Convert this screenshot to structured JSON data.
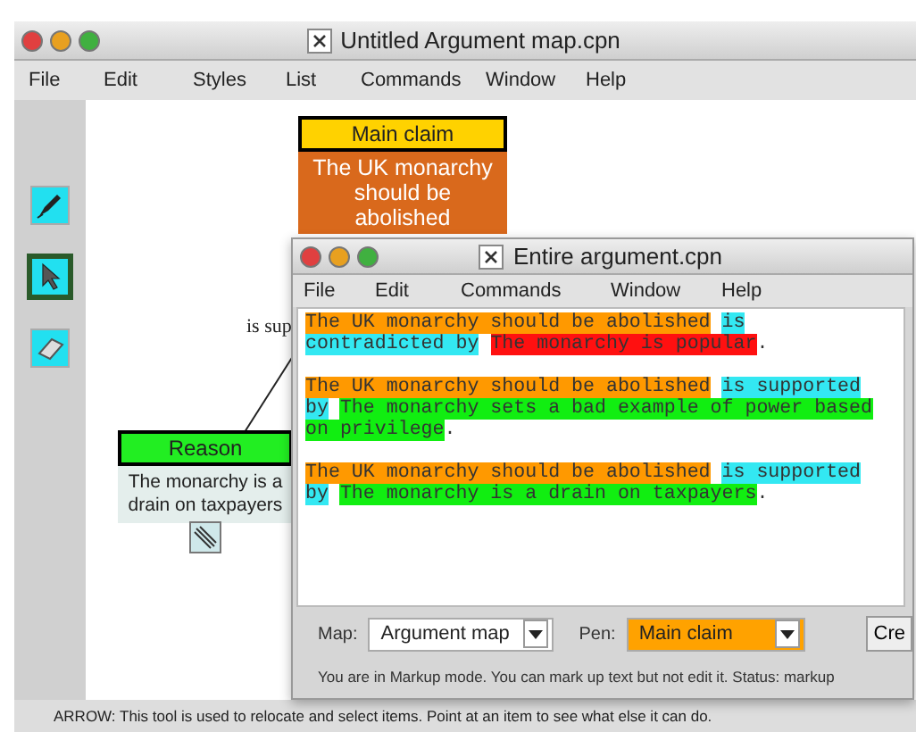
{
  "main_window": {
    "title": "Untitled Argument map.cpn",
    "menu": [
      "File",
      "Edit",
      "Styles",
      "List",
      "Commands",
      "Window",
      "Help"
    ]
  },
  "tools": [
    {
      "kind": "pen",
      "selected": false
    },
    {
      "kind": "arrow",
      "selected": true
    },
    {
      "kind": "eraser",
      "selected": false
    }
  ],
  "map": {
    "main_claim": {
      "heading": "Main claim",
      "text": "The UK monarchy should be abolished"
    },
    "relation_label": "is sup",
    "reason": {
      "heading": "Reason",
      "text": "The monarchy is a drain on taxpayers"
    }
  },
  "status_bar": "ARROW: This tool is used to relocate and select items. Point at an item to see what else it can do.",
  "text_window": {
    "title": "Entire argument.cpn",
    "menu": [
      "File",
      "Edit",
      "Commands",
      "Window",
      "Help"
    ],
    "paragraphs": [
      [
        {
          "kind": "claim",
          "text": "The UK monarchy should be abolished"
        },
        {
          "kind": "relation",
          "text": "is contradicted by"
        },
        {
          "kind": "objection",
          "text": "The monarchy is popular"
        },
        {
          "kind": "plain",
          "text": "."
        }
      ],
      [
        {
          "kind": "claim",
          "text": "The UK monarchy should be abolished"
        },
        {
          "kind": "relation",
          "text": "is supported by"
        },
        {
          "kind": "reason",
          "text": "The monarchy sets a bad example of power based on privilege"
        },
        {
          "kind": "plain",
          "text": "."
        }
      ],
      [
        {
          "kind": "claim",
          "text": "The UK monarchy should be abolished"
        },
        {
          "kind": "relation",
          "text": "is supported by"
        },
        {
          "kind": "reason",
          "text": "The monarchy is a drain on taxpayers"
        },
        {
          "kind": "plain",
          "text": "."
        }
      ]
    ],
    "map_label": "Map:",
    "map_value": "Argument map",
    "pen_label": "Pen:",
    "pen_value": "Main claim",
    "button": "Cre",
    "status": "You are in Markup mode. You can mark up text but not edit it.  Status: markup"
  }
}
